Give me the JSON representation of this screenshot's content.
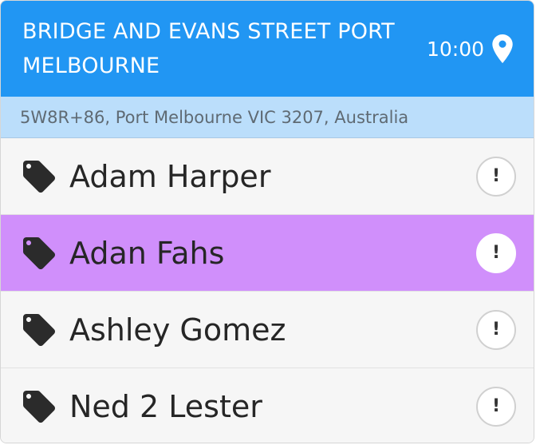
{
  "header": {
    "title": "BRIDGE AND EVANS STREET PORT MELBOURNE",
    "time": "10:00",
    "pin_icon": "map-pin-icon"
  },
  "subheader": {
    "address": "5W8R+86, Port Melbourne VIC 3207, Australia"
  },
  "people": [
    {
      "name": "Adam Harper",
      "icon": "tag-icon",
      "alert": "!",
      "selected": false
    },
    {
      "name": "Adan Fahs",
      "icon": "tag-icon",
      "alert": "!",
      "selected": true
    },
    {
      "name": "Ashley Gomez",
      "icon": "tag-icon",
      "alert": "!",
      "selected": false
    },
    {
      "name": "Ned 2 Lester",
      "icon": "tag-icon",
      "alert": "!",
      "selected": false
    }
  ],
  "colors": {
    "header_bg": "#2196f3",
    "subheader_bg": "#bbdefb",
    "selected_bg": "#d08ffb",
    "row_bg": "#f6f6f6"
  }
}
